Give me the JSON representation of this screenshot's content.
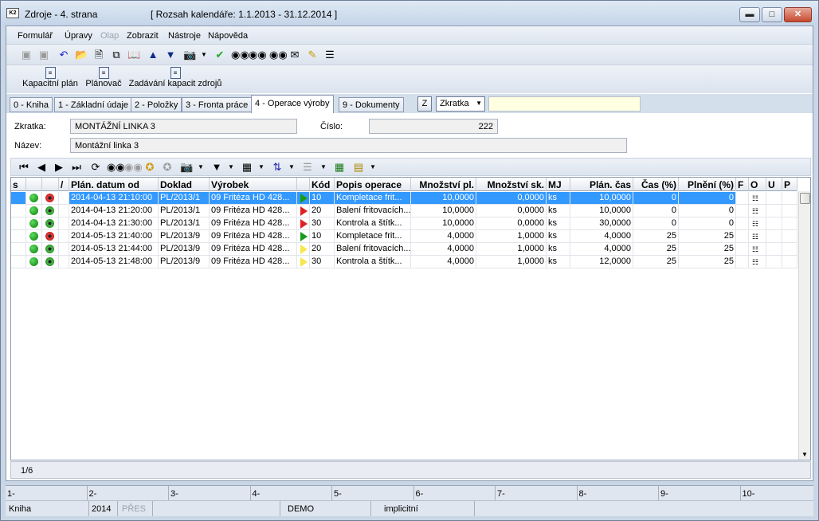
{
  "window": {
    "title": "Zdroje - 4. strana",
    "subtitle": "[ Rozsah kalendáře: 1.1.2013 - 31.12.2014 ]",
    "icon_text": "K2"
  },
  "menu": [
    "Formulář",
    "Úpravy",
    "Olap",
    "Zobrazit",
    "Nástroje",
    "Nápověda"
  ],
  "actions": [
    "Kapacitní plán",
    "Plánovač",
    "Zadávání kapacit zdrojů"
  ],
  "tabs": [
    "0 - Kniha",
    "1 - Základní údaje",
    "2 - Položky",
    "3 - Fronta práce",
    "4 - Operace výroby",
    "9 - Dokumenty"
  ],
  "active_tab": 4,
  "filter": {
    "z_label": "Z",
    "field_value": "Zkratka",
    "input_value": ""
  },
  "form": {
    "zkratka_label": "Zkratka:",
    "zkratka_value": "MONTÁŽNÍ LINKA 3",
    "cislo_label": "Číslo:",
    "cislo_value": "222",
    "nazev_label": "Název:",
    "nazev_value": "Montážní linka 3"
  },
  "grid": {
    "headers": [
      "s",
      "",
      "",
      "/",
      "Plán. datum od",
      "Doklad",
      "Výrobek",
      "",
      "Kód",
      "Popis operace",
      "Množství pl.",
      "Množství sk.",
      "MJ",
      "Plán. čas",
      "Čas (%)",
      "Plnění (%)",
      "F",
      "O",
      "U",
      "P"
    ],
    "rows": [
      {
        "status": "red",
        "date": "2014-04-13 21:10:00",
        "doklad": "PL/2013/1",
        "vyrobek": "09 Fritéza HD 428...",
        "flag": "green",
        "kod": "10",
        "popis": "Kompletace frit...",
        "mpl": "10,0000",
        "msk": "0,0000",
        "mj": "ks",
        "cas": "10,0000",
        "casp": "0",
        "plneni": "0",
        "selected": true
      },
      {
        "status": "greendark",
        "date": "2014-04-13 21:20:00",
        "doklad": "PL/2013/1",
        "vyrobek": "09 Fritéza HD 428...",
        "flag": "red",
        "kod": "20",
        "popis": "Balení fritovacích...",
        "mpl": "10,0000",
        "msk": "0,0000",
        "mj": "ks",
        "cas": "10,0000",
        "casp": "0",
        "plneni": "0"
      },
      {
        "status": "greendark",
        "date": "2014-04-13 21:30:00",
        "doklad": "PL/2013/1",
        "vyrobek": "09 Fritéza HD 428...",
        "flag": "red",
        "kod": "30",
        "popis": "Kontrola a štítk...",
        "mpl": "10,0000",
        "msk": "0,0000",
        "mj": "ks",
        "cas": "30,0000",
        "casp": "0",
        "plneni": "0"
      },
      {
        "status": "red",
        "date": "2014-05-13 21:40:00",
        "doklad": "PL/2013/9",
        "vyrobek": "09 Fritéza HD 428...",
        "flag": "green",
        "kod": "10",
        "popis": "Kompletace frit...",
        "mpl": "4,0000",
        "msk": "1,0000",
        "mj": "ks",
        "cas": "4,0000",
        "casp": "25",
        "plneni": "25"
      },
      {
        "status": "greendark",
        "date": "2014-05-13 21:44:00",
        "doklad": "PL/2013/9",
        "vyrobek": "09 Fritéza HD 428...",
        "flag": "yellow",
        "kod": "20",
        "popis": "Balení fritovacích...",
        "mpl": "4,0000",
        "msk": "1,0000",
        "mj": "ks",
        "cas": "4,0000",
        "casp": "25",
        "plneni": "25"
      },
      {
        "status": "greendark",
        "date": "2014-05-13 21:48:00",
        "doklad": "PL/2013/9",
        "vyrobek": "09 Fritéza HD 428...",
        "flag": "yellow",
        "kod": "30",
        "popis": "Kontrola a štítk...",
        "mpl": "4,0000",
        "msk": "1,0000",
        "mj": "ks",
        "cas": "12,0000",
        "casp": "25",
        "plneni": "25"
      }
    ]
  },
  "record_count": "1/6",
  "status_top": [
    "1-",
    "2-",
    "3-",
    "4-",
    "5-",
    "6-",
    "7-",
    "8-",
    "9-",
    "10-"
  ],
  "status_bottom": {
    "book": "Kniha",
    "year": "2014",
    "mode": "PŘES",
    "db": "DEMO",
    "type": "implicitní"
  }
}
